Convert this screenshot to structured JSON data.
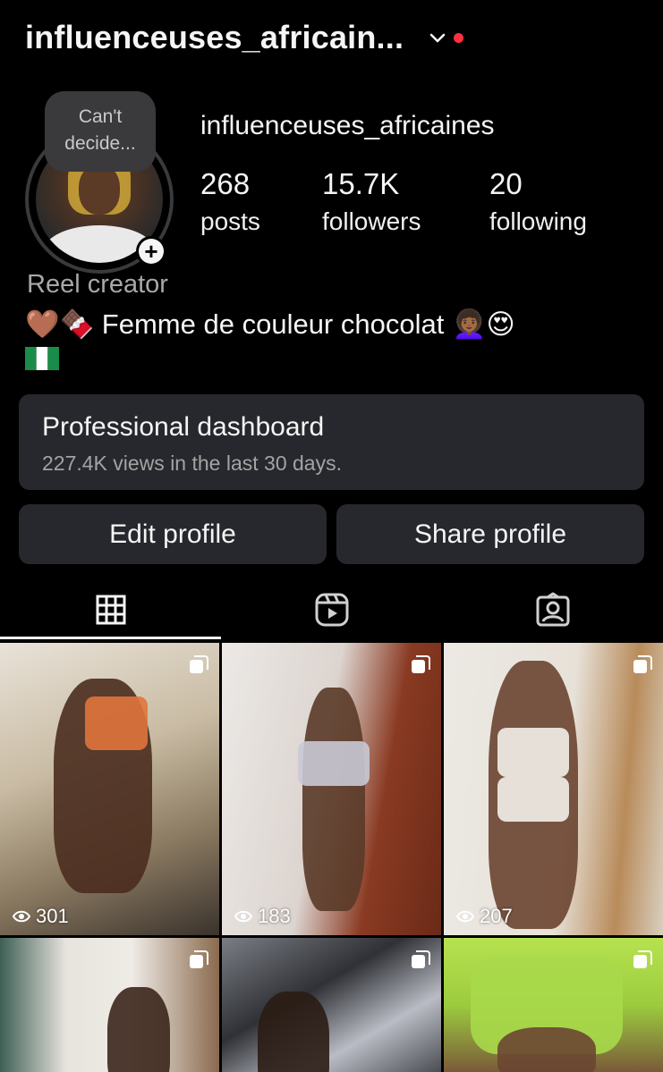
{
  "header": {
    "username": "influenceuses_africain...",
    "accent_dot_color": "#ff3040"
  },
  "profile": {
    "note": "Can't decide...",
    "handle": "influenceuses_africaines",
    "stats": [
      {
        "value": "268",
        "label": "posts"
      },
      {
        "value": "15.7K",
        "label": "followers"
      },
      {
        "value": "20",
        "label": "following"
      }
    ],
    "category": "Reel creator",
    "bio": "🤎🍫 Femme de couleur chocolat 👩🏾‍🦱😍",
    "bio_flag": "🇳🇬"
  },
  "dashboard": {
    "title": "Professional dashboard",
    "subtitle": "227.4K views in the last 30 days."
  },
  "buttons": {
    "edit": "Edit profile",
    "share": "Share profile"
  },
  "tabs": [
    {
      "icon": "grid-icon",
      "active": true
    },
    {
      "icon": "reels-icon",
      "active": false
    },
    {
      "icon": "tagged-icon",
      "active": false
    }
  ],
  "posts": [
    {
      "views": "301",
      "multi": true
    },
    {
      "views": "183",
      "multi": true
    },
    {
      "views": "207",
      "multi": true
    },
    {
      "views": "",
      "multi": true
    },
    {
      "views": "",
      "multi": true
    },
    {
      "views": "",
      "multi": true
    }
  ]
}
